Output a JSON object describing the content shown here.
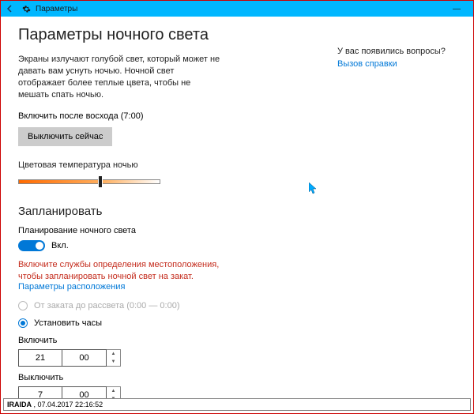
{
  "titlebar": {
    "title": "Параметры"
  },
  "header": {
    "title": "Параметры ночного света"
  },
  "description": "Экраны излучают голубой свет, который может не давать вам уснуть ночью. Ночной свет отображает более теплые цвета, чтобы не мешать спать ночью.",
  "afterSunrise": {
    "label": "Включить после восхода (7:00)"
  },
  "offNowBtn": "Выключить сейчас",
  "tempLabel": "Цветовая температура ночью",
  "tempSlider": {
    "percent": 58
  },
  "scheduleHeader": "Запланировать",
  "planLabel": "Планирование ночного света",
  "toggle": {
    "label": "Вкл.",
    "on": true
  },
  "locationWarn": "Включите службы определения местоположения, чтобы запланировать ночной свет на закат.",
  "locationLink": "Параметры расположения",
  "radioSunset": {
    "label": "От заката до рассвета (0:00 — 0:00)",
    "disabled": true,
    "checked": false
  },
  "radioCustom": {
    "label": "Установить часы",
    "checked": true
  },
  "turnOn": {
    "label": "Включить",
    "hour": "21",
    "minute": "00"
  },
  "turnOff": {
    "label": "Выключить",
    "hour": "7",
    "minute": "00"
  },
  "side": {
    "question": "У вас появились вопросы?",
    "helpLink": "Вызов справки"
  },
  "footer": {
    "user": "IRAIDA",
    "timestamp": "07.04.2017 22:16:52"
  }
}
